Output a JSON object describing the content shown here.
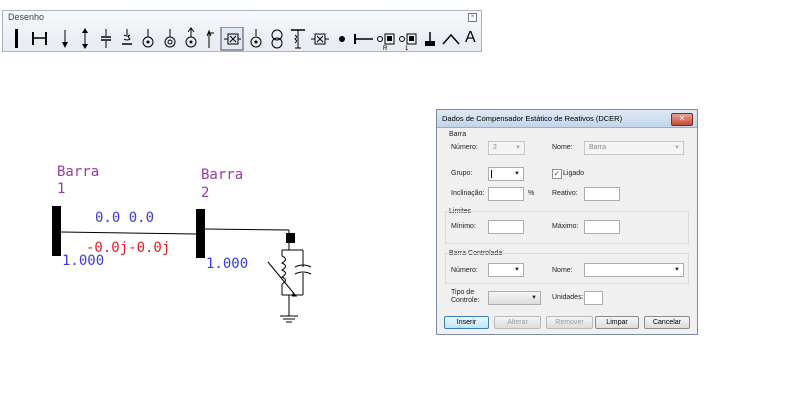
{
  "toolbar": {
    "title": "Desenho",
    "close_glyph": "×",
    "text_tool_label": "A",
    "tools": [
      "bar-tool-icon",
      "line-tool-icon",
      "load-tool-icon",
      "generator-tool-icon",
      "shunt-capacitor-tool-icon",
      "shunt-reactor-tool-icon",
      "shunt-a-tool-icon",
      "shunt-b-tool-icon",
      "shunt-c-tool-icon",
      "arrow-tool-icon",
      "static-compensator-tool-icon",
      "ground-tool-icon",
      "transformer-tool-icon",
      "three-winding-tool-icon",
      "series-device-tool-icon",
      "node-tool-icon",
      "series-line-tool-icon",
      "controlled-device-r-tool-icon",
      "controlled-device-1-tool-icon",
      "switch-tool-icon",
      "angle-tool-icon",
      "text-tool-icon"
    ],
    "active_tool": "static-compensator-tool-icon"
  },
  "diagram": {
    "bus1": {
      "name_line1": "Barra",
      "name_line2": "1",
      "voltage": "1.000"
    },
    "bus2": {
      "name_line1": "Barra",
      "name_line2": "2",
      "voltage": "1.000"
    },
    "flow_from": "0.0 0.0",
    "flow_to": "-0.0j-0.0j",
    "colors": {
      "bus": "#000000",
      "name": "#9b3aa8",
      "flow": "#3a3ae0",
      "flow_neg": "#e02020"
    }
  },
  "dialog": {
    "title": "Dados de Compensador Estático de Reativos (DCER)",
    "close_glyph": "✕",
    "barra_group": "Barra",
    "numero_label": "Número:",
    "numero_value": "2",
    "nome_label": "Nome:",
    "nome_value": "Barra",
    "grupo_label": "Grupo:",
    "grupo_value": "",
    "ligado_label": "Ligado",
    "ligado_checked": true,
    "inclinacao_label": "Inclinação:",
    "inclinacao_unit": "%",
    "reativo_label": "Reativo:",
    "limites_group": "Limites",
    "minimo_label": "Mínimo:",
    "maximo_label": "Máximo:",
    "barra_controlada_group": "Barra Controlada",
    "bc_numero_label": "Número:",
    "bc_nome_label": "Nome:",
    "tipo_label_line1": "Tipo de",
    "tipo_label_line2": "Controle:",
    "unidades_label": "Unidades:",
    "buttons": {
      "inserir": "Inserir",
      "alterar": "Alterar",
      "remover": "Remover",
      "limpar": "Limpar",
      "cancelar": "Cancelar"
    },
    "dropdown_arrow": "▼"
  }
}
